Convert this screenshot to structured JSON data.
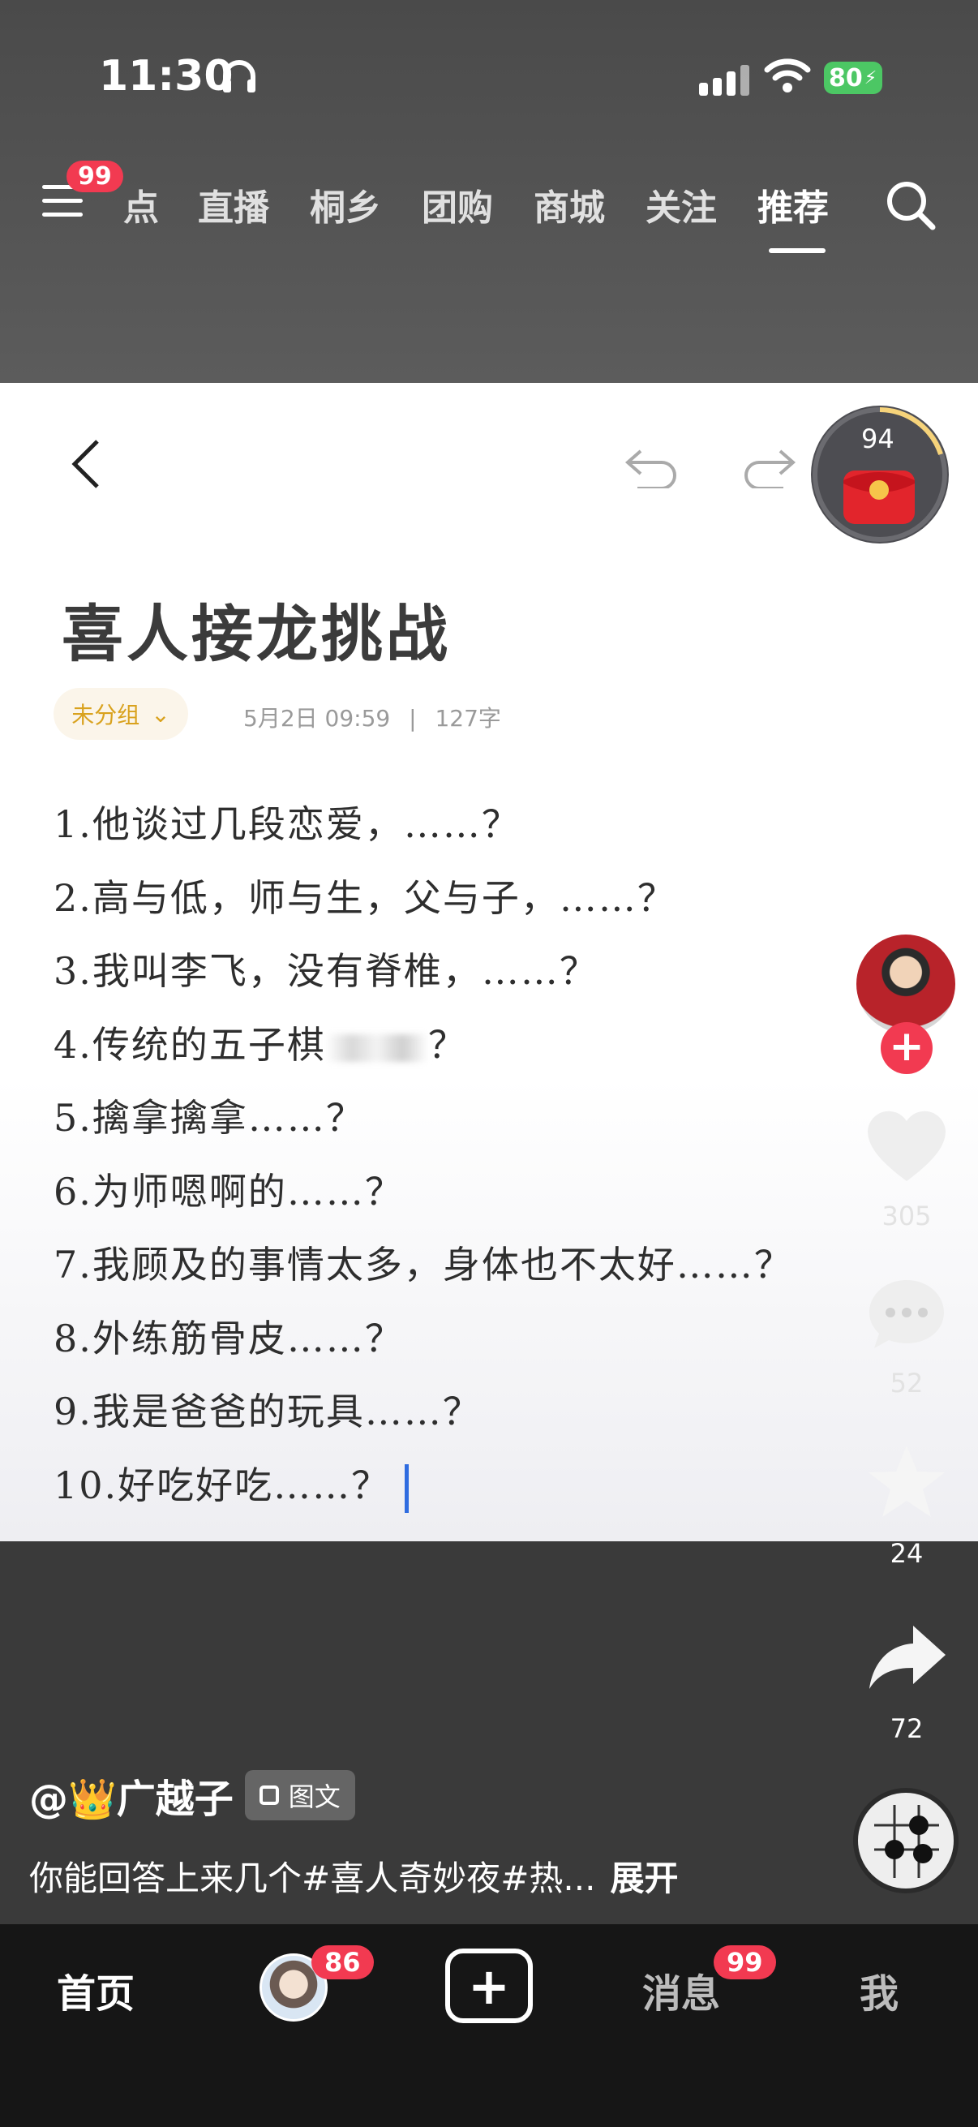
{
  "status_bar": {
    "time": "11:30",
    "battery": "80"
  },
  "top_nav": {
    "menu_badge": "99",
    "tabs": [
      "点",
      "直播",
      "桐乡",
      "团购",
      "商城",
      "关注",
      "推荐"
    ],
    "active_tab": "推荐"
  },
  "note": {
    "title": "喜人接龙挑战",
    "group": "未分组",
    "date": "5月2日 09:59",
    "word_count": "127字",
    "lines": [
      "1.他谈过几段恋爱，……？",
      "2.高与低，师与生，父与子，……？",
      "3.我叫李飞，没有脊椎，……？",
      "4.传统的五子棋",
      "5.擒拿擒拿……？",
      "6.为师嗯啊的……？",
      "7.我顾及的事情太多，身体也不太好……？",
      "8.外练筋骨皮……？",
      "9.我是爸爸的玩具……？",
      "10.好吃好吃……？"
    ],
    "line4_suffix": "？"
  },
  "reward": {
    "count": "94"
  },
  "rail": {
    "likes": "305",
    "comments": "52",
    "favorites": "24",
    "shares": "72"
  },
  "caption": {
    "author": "@👑广越子",
    "type_badge": "图文",
    "text": "你能回答上来几个#喜人奇妙夜#热...",
    "expand": "展开"
  },
  "bottom_nav": {
    "home": "首页",
    "friends_badge": "86",
    "messages": "消息",
    "messages_badge": "99",
    "me": "我"
  },
  "colors": {
    "badge": "#f23a51",
    "accent_gold": "#d9a21e",
    "cursor": "#2f6ce0"
  }
}
